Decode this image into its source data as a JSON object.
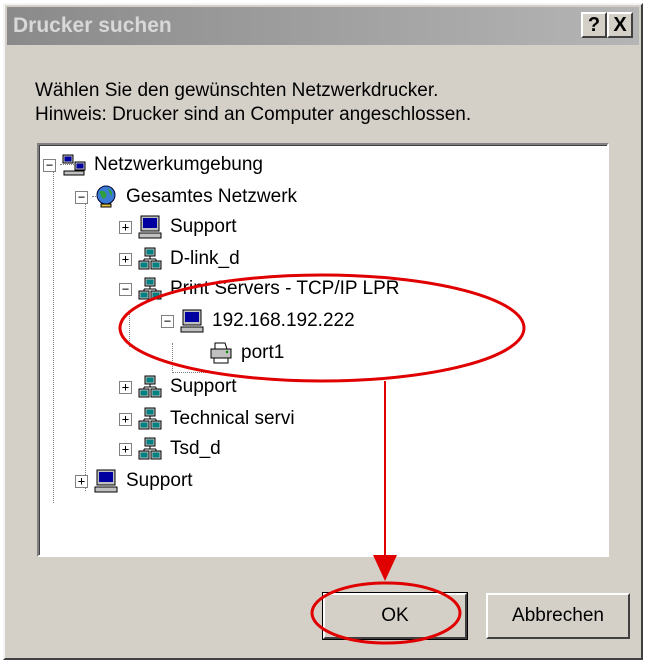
{
  "window": {
    "title": "Drucker suchen",
    "help_label": "?",
    "close_label": "X"
  },
  "instructions": {
    "line1": "Wählen Sie den gewünschten Netzwerkdrucker.",
    "line2": "Hinweis: Drucker sind an Computer angeschlossen."
  },
  "tree": {
    "nodes": [
      {
        "label": "Netzwerkumgebung",
        "expander": "−",
        "icon": "network-neighborhood-icon"
      },
      {
        "label": "Gesamtes Netzwerk",
        "expander": "−",
        "icon": "globe-icon"
      },
      {
        "label": "Support",
        "expander": "+",
        "icon": "computer-icon"
      },
      {
        "label": "D-link_d",
        "expander": "+",
        "icon": "workgroup-icon"
      },
      {
        "label": "Print Servers - TCP/IP LPR",
        "expander": "−",
        "icon": "workgroup-icon"
      },
      {
        "label": "192.168.192.222",
        "expander": "−",
        "icon": "computer-icon"
      },
      {
        "label": "port1",
        "expander": "",
        "icon": "printer-icon"
      },
      {
        "label": "Support",
        "expander": "+",
        "icon": "workgroup-icon"
      },
      {
        "label": "Technical servi",
        "expander": "+",
        "icon": "workgroup-icon"
      },
      {
        "label": "Tsd_d",
        "expander": "+",
        "icon": "workgroup-icon"
      },
      {
        "label": "Support",
        "expander": "+",
        "icon": "computer-icon"
      }
    ]
  },
  "buttons": {
    "ok_label": "OK",
    "cancel_label": "Abbrechen"
  },
  "annotation": {
    "color": "#e00000"
  }
}
